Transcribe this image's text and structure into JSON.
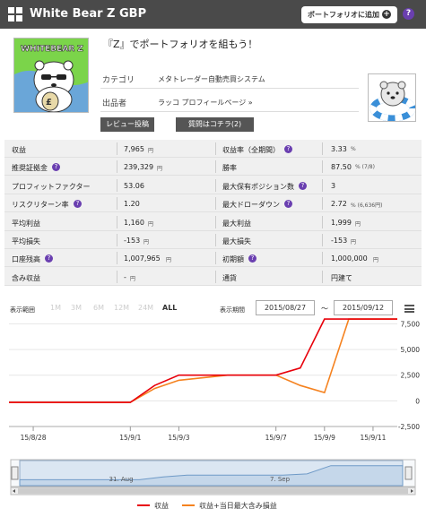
{
  "header": {
    "title": "White Bear Z GBP",
    "add_button": "ポートフォリオに追加",
    "add_plus": "+",
    "help": "?"
  },
  "logo_text": "WHITEBEAR Z",
  "intro": "『Z』でポートフォリオを組もう！",
  "meta": {
    "category_label": "カテゴリ",
    "category_value": "メタトレーダー自動売買システム",
    "seller_label": "出品者",
    "seller_value": "ラッコ プロフィールページ »"
  },
  "buttons": {
    "review": "レビュー投稿",
    "question": "質問はコチラ(2)"
  },
  "stats": [
    {
      "l": "収益",
      "lq": false,
      "lv": "7,965",
      "lu": "円",
      "r": "収益率（全期間）",
      "rq": true,
      "rv": "3.33",
      "ru": "%"
    },
    {
      "l": "推奨証拠金",
      "lq": true,
      "lv": "239,329",
      "lu": "円",
      "r": "勝率",
      "rq": false,
      "rv": "87.50",
      "ru": "% (7/8)"
    },
    {
      "l": "プロフィットファクター",
      "lq": false,
      "lv": "53.06",
      "lu": "",
      "r": "最大保有ポジション数",
      "rq": true,
      "rv": "3",
      "ru": ""
    },
    {
      "l": "リスクリターン率",
      "lq": true,
      "lv": "1.20",
      "lu": "",
      "r": "最大ドローダウン",
      "rq": true,
      "rv": "2.72",
      "ru": "% (6,636円)"
    },
    {
      "l": "平均利益",
      "lq": false,
      "lv": "1,160",
      "lu": "円",
      "r": "最大利益",
      "rq": false,
      "rv": "1,999",
      "ru": "円"
    },
    {
      "l": "平均損失",
      "lq": false,
      "lv": "-153",
      "lu": "円",
      "r": "最大損失",
      "rq": false,
      "rv": "-153",
      "ru": "円"
    },
    {
      "l": "口座残高",
      "lq": true,
      "lv": "1,007,965",
      "lu": "円",
      "r": "初期額",
      "rq": true,
      "rv": "1,000,000",
      "ru": "円"
    },
    {
      "l": "含み収益",
      "lq": false,
      "lv": "-",
      "lu": "円",
      "r": "通貨",
      "rq": false,
      "rv": "円建て",
      "ru": ""
    }
  ],
  "chart_controls": {
    "range_label": "表示範囲",
    "zoom": [
      "1M",
      "3M",
      "6M",
      "12M",
      "24M",
      "ALL"
    ],
    "active_zoom": "ALL",
    "period_label": "表示期間",
    "from": "2015/08/27",
    "to": "2015/09/12",
    "tilde": "～"
  },
  "chart_data": {
    "type": "line",
    "x_ticks": [
      "15/8/28",
      "15/9/1",
      "15/9/3",
      "15/9/7",
      "15/9/9",
      "15/9/11"
    ],
    "y_ticks": [
      "7,500",
      "5,000",
      "2,500",
      "0",
      "-2,500"
    ],
    "ylim": [
      -2500,
      7800
    ],
    "series": [
      {
        "name": "収益",
        "color": "#e8000b",
        "points": [
          [
            "2015/08/27",
            -153
          ],
          [
            "2015/09/01",
            -153
          ],
          [
            "2015/09/02",
            1500
          ],
          [
            "2015/09/03",
            2500
          ],
          [
            "2015/09/07",
            2500
          ],
          [
            "2015/09/08",
            3200
          ],
          [
            "2015/09/09",
            7965
          ],
          [
            "2015/09/12",
            7965
          ]
        ]
      },
      {
        "name": "収益+当日最大含み損益",
        "color": "#f5821f",
        "points": [
          [
            "2015/08/27",
            -153
          ],
          [
            "2015/09/01",
            -153
          ],
          [
            "2015/09/02",
            1200
          ],
          [
            "2015/09/03",
            2000
          ],
          [
            "2015/09/05",
            2500
          ],
          [
            "2015/09/07",
            2500
          ],
          [
            "2015/09/08",
            1500
          ],
          [
            "2015/09/09",
            800
          ],
          [
            "2015/09/10",
            7965
          ],
          [
            "2015/09/12",
            7965
          ]
        ]
      }
    ],
    "navigator_labels": [
      "31. Aug",
      "7. Sep"
    ]
  },
  "legend": [
    "収益",
    "収益+当日最大含み損益"
  ],
  "colors": {
    "header": "#4a4a4a",
    "accent_purple": "#6a3fb0",
    "red": "#e8000b",
    "orange": "#f5821f"
  }
}
